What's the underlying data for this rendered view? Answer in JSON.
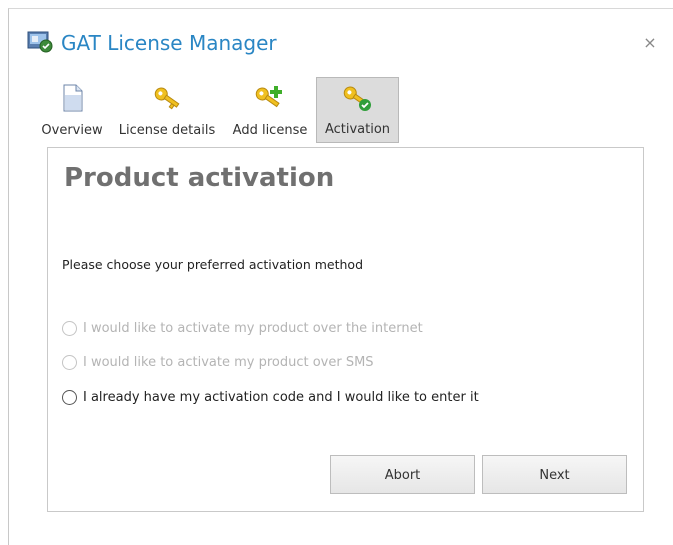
{
  "window": {
    "title": "GAT License Manager",
    "close_glyph": "×"
  },
  "tabs": [
    {
      "label": "Overview",
      "icon": "document-icon",
      "active": false
    },
    {
      "label": "License details",
      "icon": "key-icon",
      "active": false
    },
    {
      "label": "Add license",
      "icon": "key-add-icon",
      "active": false
    },
    {
      "label": "Activation",
      "icon": "key-check-icon",
      "active": true
    }
  ],
  "content": {
    "heading": "Product activation",
    "prompt": "Please choose your preferred activation method",
    "options": [
      {
        "label": "I would like to activate my product over the internet",
        "enabled": false,
        "selected": false
      },
      {
        "label": "I would like to activate my product over SMS",
        "enabled": false,
        "selected": false
      },
      {
        "label": "I already have my activation code and I would like to enter it",
        "enabled": true,
        "selected": false
      }
    ]
  },
  "buttons": {
    "abort": "Abort",
    "next": "Next"
  },
  "colors": {
    "title": "#2a86c4",
    "key_gold": "#f0c020",
    "add_green": "#3fae2a",
    "check_green": "#2f9e3a"
  }
}
